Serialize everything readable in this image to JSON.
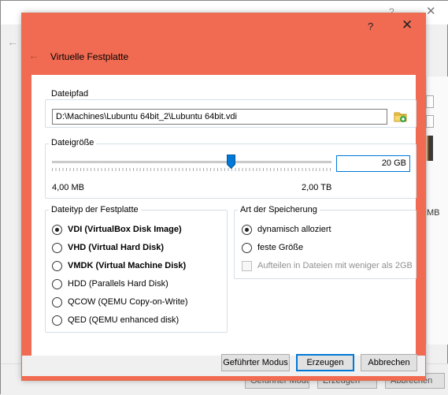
{
  "background_window": {
    "help_label": "?",
    "close_label": "✕",
    "size_unit_fragment": "MB",
    "buttons": [
      "Geführter Modus",
      "Erzeugen",
      "Abbrechen"
    ]
  },
  "dialog": {
    "title": "Virtuelle Festplatte",
    "help_label": "?",
    "close_label": "✕",
    "accent_color": "#f16b52"
  },
  "file_path": {
    "group_label": "Dateipfad",
    "value": "D:\\Machines\\Lubuntu 64bit_2\\Lubuntu 64bit.vdi",
    "browse_icon": "folder-icon"
  },
  "file_size": {
    "group_label": "Dateigröße",
    "value": "20 GB",
    "min_label": "4,00 MB",
    "max_label": "2,00 TB",
    "slider_position_fraction": 0.64
  },
  "disk_type": {
    "group_label": "Dateityp der Festplatte",
    "options": [
      {
        "label": "VDI (VirtualBox Disk Image)",
        "checked": true,
        "bold": true
      },
      {
        "label": "VHD (Virtual Hard Disk)",
        "checked": false,
        "bold": true
      },
      {
        "label": "VMDK (Virtual Machine Disk)",
        "checked": false,
        "bold": true
      },
      {
        "label": "HDD (Parallels Hard Disk)",
        "checked": false,
        "bold": false
      },
      {
        "label": "QCOW (QEMU Copy-on-Write)",
        "checked": false,
        "bold": false
      },
      {
        "label": "QED (QEMU enhanced disk)",
        "checked": false,
        "bold": false
      }
    ]
  },
  "storage": {
    "group_label": "Art der Speicherung",
    "options": [
      {
        "label": "dynamisch alloziert",
        "checked": true
      },
      {
        "label": "feste Größe",
        "checked": false
      }
    ],
    "split_checkbox_label": "Aufteilen in Dateien mit weniger als 2GB",
    "split_checkbox_checked": false,
    "split_checkbox_enabled": false
  },
  "footer": {
    "guided_mode_label": "Geführter Modus",
    "create_label": "Erzeugen",
    "cancel_label": "Abbrechen"
  }
}
